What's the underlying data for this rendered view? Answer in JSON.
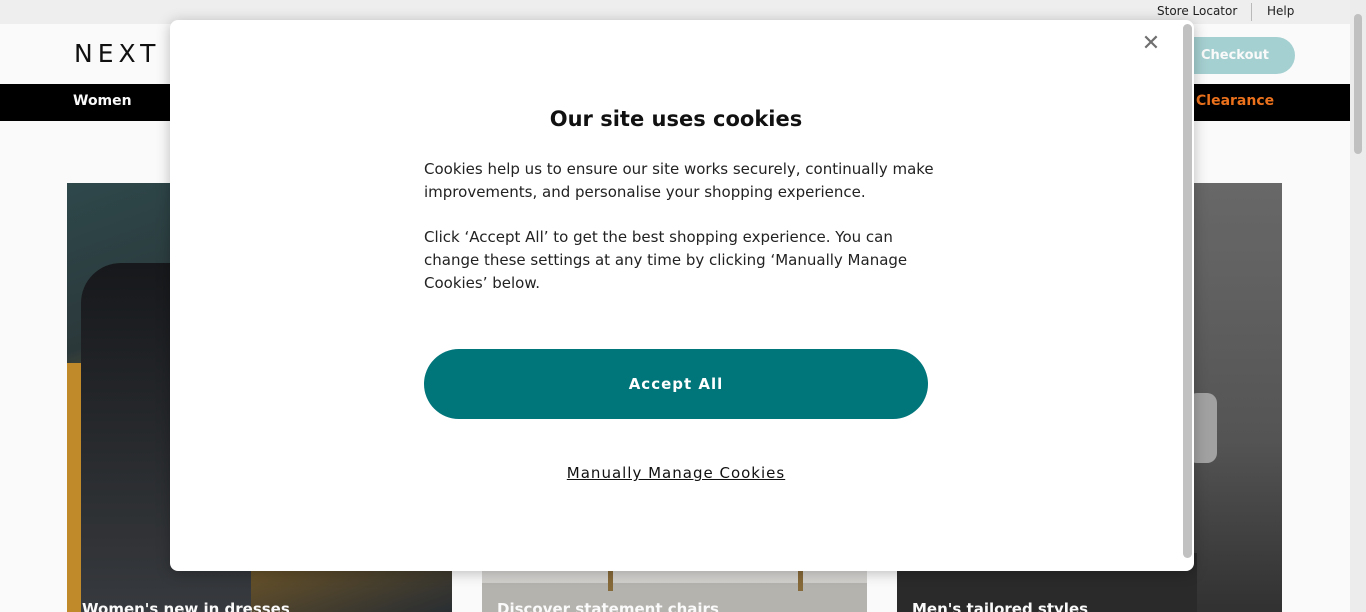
{
  "utility": {
    "store_locator": "Store Locator",
    "help": "Help"
  },
  "header": {
    "logo": "NEXT",
    "checkout_label": "Checkout"
  },
  "nav": {
    "items": [
      {
        "label": "Women"
      },
      {
        "label": "Clearance"
      }
    ]
  },
  "tiles": [
    {
      "title": "Women's new in dresses"
    },
    {
      "title": "Discover statement chairs"
    },
    {
      "title": "Men's tailored styles"
    }
  ],
  "cookie_modal": {
    "title": "Our site uses cookies",
    "paragraph_1": "Cookies help us to ensure our site works securely, continually make improvements, and personalise your shopping experience.",
    "paragraph_2": "Click ‘Accept All’ to get the best shopping experience. You can change these settings at any time by clicking ‘Manually Manage Cookies’ below.",
    "accept_label": "Accept All",
    "manage_label": "Manually Manage Cookies",
    "close_glyph": "✕"
  },
  "colors": {
    "accent": "#00757a",
    "checkout": "#a9d5d6",
    "clearance": "#f0741d",
    "nav_bg": "#000000"
  }
}
